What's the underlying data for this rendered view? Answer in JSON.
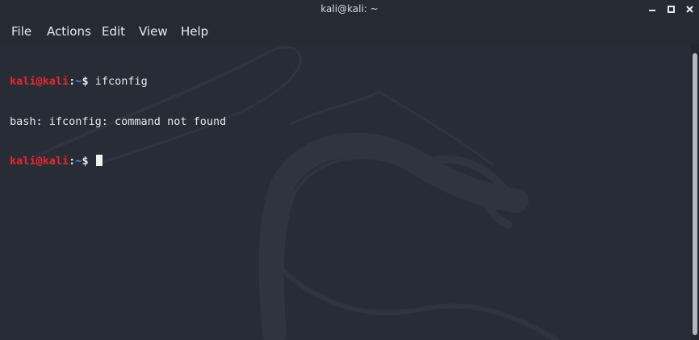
{
  "window": {
    "title": "kali@kali: ~"
  },
  "menu": {
    "items": [
      "File",
      "Actions",
      "Edit",
      "View",
      "Help"
    ]
  },
  "terminal": {
    "prompt_user": "kali@kali",
    "prompt_sep": ":",
    "prompt_path": "~",
    "prompt_symbol": "$",
    "command_1": " ifconfig",
    "output_1": "bash: ifconfig: command not found"
  },
  "colors": {
    "background": "#272c37",
    "prompt_user": "#e8282f",
    "prompt_path": "#3b8eea",
    "text": "#e8e8e8"
  },
  "icons": {
    "minimize": "minimize-icon",
    "maximize": "maximize-icon",
    "close": "close-icon",
    "watermark": "kali-dragon-icon"
  }
}
